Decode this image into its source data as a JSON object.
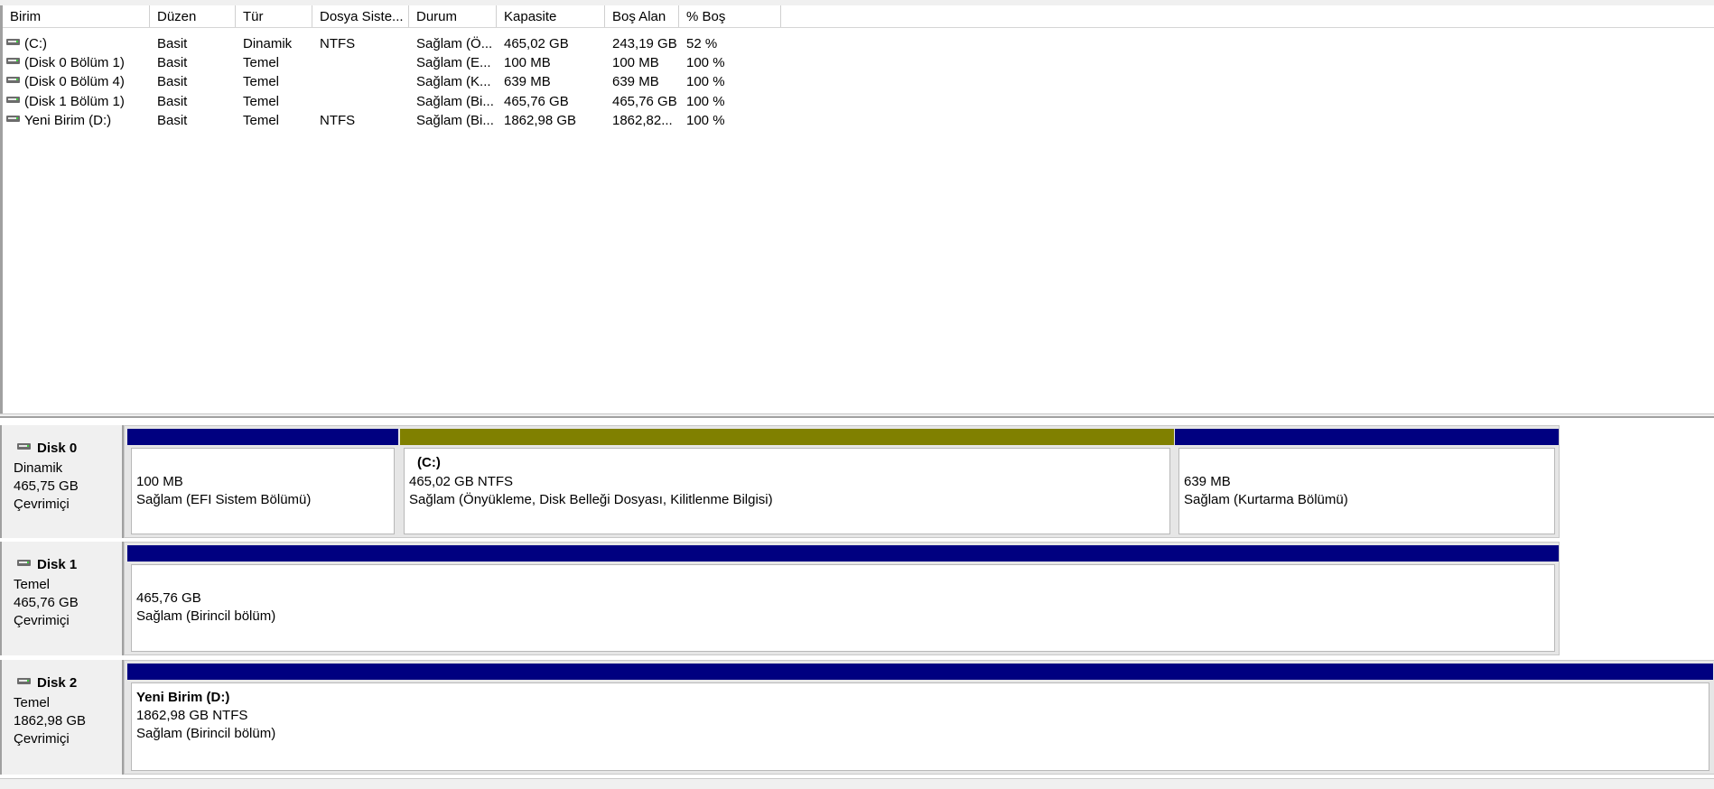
{
  "colors": {
    "primary_partition_bar": "#000080",
    "dynamic_volume_bar": "#808000",
    "pane_background": "#f0f0f0"
  },
  "volume_list": {
    "columns": [
      "Birim",
      "Düzen",
      "Tür",
      "Dosya Siste...",
      "Durum",
      "Kapasite",
      "Boş Alan",
      "% Boş"
    ],
    "rows": [
      {
        "icon": "drive-icon",
        "name": "(C:)",
        "layout": "Basit",
        "type": "Dinamik",
        "fs": "NTFS",
        "status": "Sağlam (Ö...",
        "capacity": "465,02 GB",
        "free": "243,19 GB",
        "pct": "52 %"
      },
      {
        "icon": "drive-icon",
        "name": "(Disk 0 Bölüm 1)",
        "layout": "Basit",
        "type": "Temel",
        "fs": "",
        "status": "Sağlam (E...",
        "capacity": "100 MB",
        "free": "100 MB",
        "pct": "100 %"
      },
      {
        "icon": "drive-icon",
        "name": "(Disk 0 Bölüm 4)",
        "layout": "Basit",
        "type": "Temel",
        "fs": "",
        "status": "Sağlam (K...",
        "capacity": "639 MB",
        "free": "639 MB",
        "pct": "100 %"
      },
      {
        "icon": "drive-icon",
        "name": "(Disk 1 Bölüm 1)",
        "layout": "Basit",
        "type": "Temel",
        "fs": "",
        "status": "Sağlam (Bi...",
        "capacity": "465,76 GB",
        "free": "465,76 GB",
        "pct": "100 %"
      },
      {
        "icon": "drive-icon",
        "name": "Yeni Birim (D:)",
        "layout": "Basit",
        "type": "Temel",
        "fs": "NTFS",
        "status": "Sağlam (Bi...",
        "capacity": "1862,98 GB",
        "free": "1862,82...",
        "pct": "100 %"
      }
    ]
  },
  "disks": [
    {
      "title": "Disk 0",
      "icon": "disk-icon",
      "type": "Dinamik",
      "size": "465,75 GB",
      "state": "Çevrimiçi",
      "partitions": [
        {
          "bar": "primary",
          "name": "",
          "size": "100 MB",
          "status": "Sağlam (EFI Sistem Bölümü)"
        },
        {
          "bar": "dynamic",
          "name": "(C:)",
          "size": "465,02 GB NTFS",
          "status": "Sağlam (Önyükleme, Disk Belleği Dosyası, Kilitlenme Bilgisi)"
        },
        {
          "bar": "primary",
          "name": "",
          "size": "639 MB",
          "status": "Sağlam (Kurtarma Bölümü)"
        }
      ]
    },
    {
      "title": "Disk 1",
      "icon": "disk-icon",
      "type": "Temel",
      "size": "465,76 GB",
      "state": "Çevrimiçi",
      "partitions": [
        {
          "bar": "primary",
          "name": "",
          "size": "465,76 GB",
          "status": "Sağlam (Birincil bölüm)"
        }
      ]
    },
    {
      "title": "Disk 2",
      "icon": "disk-icon",
      "type": "Temel",
      "size": "1862,98 GB",
      "state": "Çevrimiçi",
      "partitions": [
        {
          "bar": "primary",
          "name": "Yeni Birim  (D:)",
          "size": "1862,98 GB NTFS",
          "status": "Sağlam (Birincil bölüm)"
        }
      ]
    }
  ]
}
